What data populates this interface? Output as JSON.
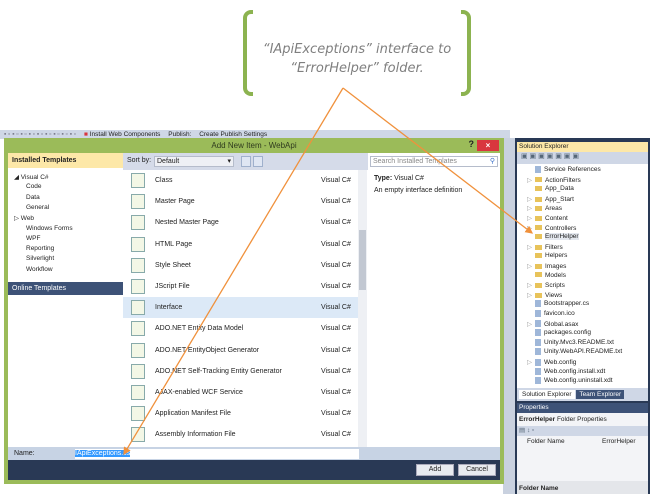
{
  "callout": {
    "line1": "“IApiExceptions” interface to",
    "line2": "“ErrorHelper” folder."
  },
  "toolbar": {
    "install": "Install Web Components",
    "publish": "Publish:",
    "publish_settings": "Create Publish Settings"
  },
  "dialog": {
    "title": "Add New Item - WebApi",
    "help": "?",
    "close": "×",
    "installed_header": "Installed Templates",
    "tree": [
      "◢ Visual C#",
      "Code",
      "Data",
      "General",
      "▷ Web",
      "Windows Forms",
      "WPF",
      "Reporting",
      "Silverlight",
      "Workflow"
    ],
    "online": "Online Templates",
    "sort_label": "Sort by:",
    "sort_value": "Default",
    "search_placeholder": "Search Installed Templates",
    "templates": [
      {
        "name": "Class",
        "lang": "Visual C#"
      },
      {
        "name": "Master Page",
        "lang": "Visual C#"
      },
      {
        "name": "Nested Master Page",
        "lang": "Visual C#"
      },
      {
        "name": "HTML Page",
        "lang": "Visual C#"
      },
      {
        "name": "Style Sheet",
        "lang": "Visual C#"
      },
      {
        "name": "JScript File",
        "lang": "Visual C#"
      },
      {
        "name": "Interface",
        "lang": "Visual C#"
      },
      {
        "name": "ADO.NET Entity Data Model",
        "lang": "Visual C#"
      },
      {
        "name": "ADO.NET EntityObject Generator",
        "lang": "Visual C#"
      },
      {
        "name": "ADO.NET Self-Tracking Entity Generator",
        "lang": "Visual C#"
      },
      {
        "name": "AJAX-enabled WCF Service",
        "lang": "Visual C#"
      },
      {
        "name": "Application Manifest File",
        "lang": "Visual C#"
      },
      {
        "name": "Assembly Information File",
        "lang": "Visual C#"
      }
    ],
    "type_label": "Type:",
    "type_value": "Visual C#",
    "description": "An empty interface definition",
    "name_label": "Name:",
    "name_value": "IApiExceptions.cs",
    "add": "Add",
    "cancel": "Cancel"
  },
  "solution_explorer": {
    "title": "Solution Explorer",
    "items": [
      {
        "label": "Service References",
        "kind": "file",
        "exp": false
      },
      {
        "label": "ActionFilters",
        "kind": "folder",
        "exp": true
      },
      {
        "label": "App_Data",
        "kind": "folder",
        "exp": false
      },
      {
        "label": "App_Start",
        "kind": "folder",
        "exp": true
      },
      {
        "label": "Areas",
        "kind": "folder",
        "exp": true
      },
      {
        "label": "Content",
        "kind": "folder",
        "exp": true
      },
      {
        "label": "Controllers",
        "kind": "folder",
        "exp": true
      },
      {
        "label": "ErrorHelper",
        "kind": "folder",
        "exp": false
      },
      {
        "label": "Filters",
        "kind": "folder",
        "exp": true
      },
      {
        "label": "Helpers",
        "kind": "folder",
        "exp": false
      },
      {
        "label": "Images",
        "kind": "folder",
        "exp": true
      },
      {
        "label": "Models",
        "kind": "folder",
        "exp": false
      },
      {
        "label": "Scripts",
        "kind": "folder",
        "exp": true
      },
      {
        "label": "Views",
        "kind": "folder",
        "exp": true
      },
      {
        "label": "Bootstrapper.cs",
        "kind": "file",
        "exp": false
      },
      {
        "label": "favicon.ico",
        "kind": "file",
        "exp": false
      },
      {
        "label": "Global.asax",
        "kind": "file",
        "exp": true
      },
      {
        "label": "packages.config",
        "kind": "file",
        "exp": false
      },
      {
        "label": "Unity.Mvc3.README.txt",
        "kind": "file",
        "exp": false
      },
      {
        "label": "Unity.WebAPI.README.txt",
        "kind": "file",
        "exp": false
      },
      {
        "label": "Web.config",
        "kind": "file",
        "exp": true
      },
      {
        "label": "Web.config.install.xdt",
        "kind": "file",
        "exp": false
      },
      {
        "label": "Web.config.uninstall.xdt",
        "kind": "file",
        "exp": false
      }
    ],
    "tab1": "Solution Explorer",
    "tab2": "Team Explorer"
  },
  "properties": {
    "title": "Properties",
    "object_name": "ErrorHelper",
    "object_type": "Folder Properties",
    "prop_name": "Folder Name",
    "prop_value": "ErrorHelper",
    "desc_title": "Folder Name"
  },
  "colors": {
    "accent_green": "#9bbb59",
    "arrow": "#f0913c",
    "navy": "#293955"
  }
}
